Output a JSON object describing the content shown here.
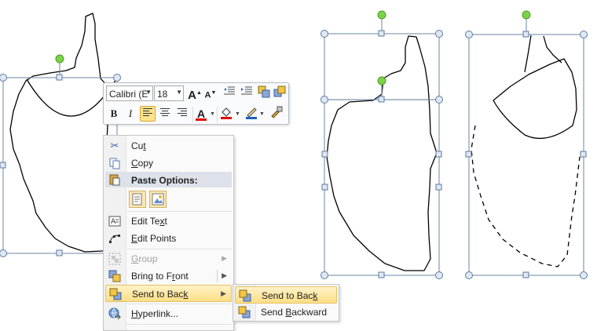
{
  "mini_toolbar": {
    "font_name": "Calibri (E",
    "font_size": "18",
    "grow_font_label": "A",
    "shrink_font_label": "A",
    "bold_label": "B",
    "italic_label": "I",
    "font_color_label": "A",
    "font_color": "#e00000",
    "fill_color": "#e00000",
    "outline_color": "#1f5fbf"
  },
  "context_menu": {
    "items": [
      {
        "label_pre": "Cu",
        "label_acc": "t",
        "label_post": "",
        "icon": "scissors-icon"
      },
      {
        "label_pre": "",
        "label_acc": "C",
        "label_post": "opy",
        "icon": "copy-icon"
      },
      {
        "label": "Paste Options:",
        "icon": "paste-icon"
      },
      {
        "label_pre": "Edit Te",
        "label_acc": "x",
        "label_post": "t",
        "icon": "edit-text-icon"
      },
      {
        "label_pre": "",
        "label_acc": "E",
        "label_post": "dit Points",
        "icon": "edit-points-icon"
      },
      {
        "label_pre": "",
        "label_acc": "G",
        "label_post": "roup",
        "icon": "group-icon"
      },
      {
        "label_pre": "Bring to F",
        "label_acc": "r",
        "label_post": "ont",
        "icon": "bring-to-front-icon"
      },
      {
        "label_pre": "Send to Bac",
        "label_acc": "k",
        "label_post": "",
        "icon": "send-to-back-icon"
      },
      {
        "label_pre": "",
        "label_acc": "H",
        "label_post": "yperlink...",
        "icon": "hyperlink-icon"
      }
    ]
  },
  "submenu": {
    "items": [
      {
        "label_pre": "Send to Bac",
        "label_acc": "k",
        "label_post": "",
        "icon": "send-to-back-icon"
      },
      {
        "label_pre": "Send ",
        "label_acc": "B",
        "label_post": "ackward",
        "icon": "send-backward-icon"
      }
    ]
  },
  "colors": {
    "selection_frame": "#6b84a1",
    "handle_fill": "#dfe8f3",
    "rotation_handle": "#7dd34a",
    "highlight": "#fedf85"
  }
}
